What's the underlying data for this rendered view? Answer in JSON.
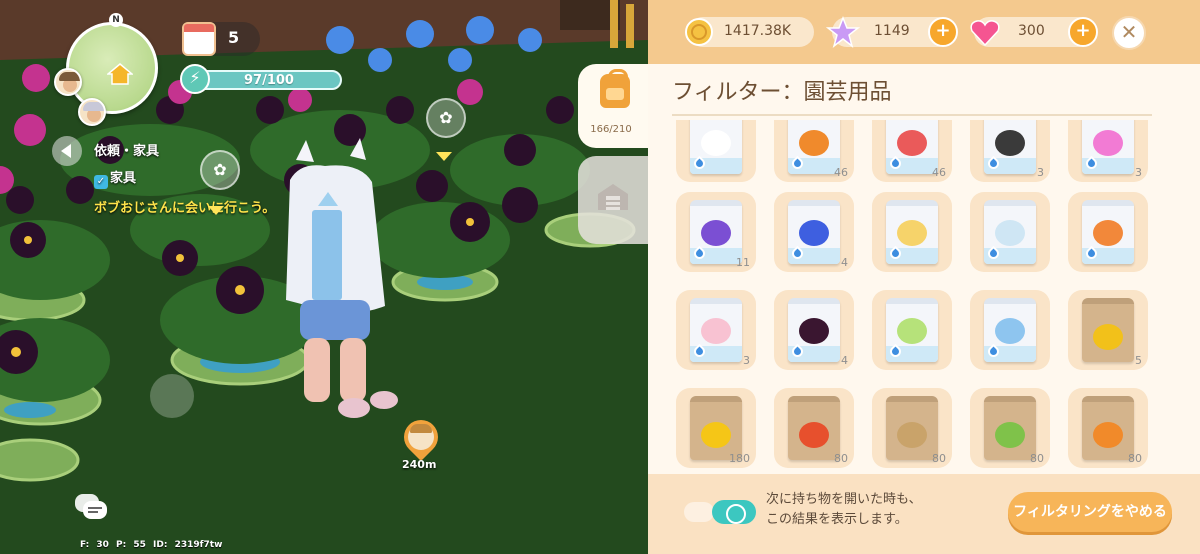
{
  "hud": {
    "minimap_north": "N",
    "quest_count": "5",
    "energy": "97/100",
    "quest_title": "依頼・家具",
    "quest_check": "✓",
    "quest_item": "家具",
    "quest_desc": "ボブおじさんに会いに行こう。",
    "npc_distance": "240m",
    "footer": "F: 30   P: 55   ID: 2319f7tw"
  },
  "side_tabs": {
    "bag_capacity": "166/210"
  },
  "resources": {
    "coins": "1417.38K",
    "stars": "1149",
    "gems": "300",
    "plus": "+",
    "close": "✕"
  },
  "panel": {
    "title": "フィルター：園芸用品"
  },
  "items": [
    {
      "name": "white-rose-seed-pack",
      "kind": "seed",
      "color": "#ffffff",
      "qty": ""
    },
    {
      "name": "orange-rose-seed-pack",
      "kind": "seed",
      "color": "#f08a2c",
      "qty": "46"
    },
    {
      "name": "red-rose-seed-pack",
      "kind": "seed",
      "color": "#ea5a5a",
      "qty": "46"
    },
    {
      "name": "black-rose-seed-pack",
      "kind": "seed",
      "color": "#3a3a3a",
      "qty": "3"
    },
    {
      "name": "pink-rose-seed-pack",
      "kind": "seed",
      "color": "#f27bd4",
      "qty": "3"
    },
    {
      "name": "purple-rose-seed-pack",
      "kind": "seed",
      "color": "#7b4fd3",
      "qty": "11"
    },
    {
      "name": "blue-rose-seed-pack",
      "kind": "seed",
      "color": "#3e5fe0",
      "qty": "4"
    },
    {
      "name": "yellow-rose-seed-pack",
      "kind": "seed",
      "color": "#f6d36a",
      "qty": ""
    },
    {
      "name": "pale-blue-rose-seed-pack",
      "kind": "seed",
      "color": "#cfe6f4",
      "qty": ""
    },
    {
      "name": "orange-lily-seed-pack",
      "kind": "seed",
      "color": "#f2883a",
      "qty": ""
    },
    {
      "name": "pink-flower-seed-pack",
      "kind": "seed",
      "color": "#f8c2d2",
      "qty": "3"
    },
    {
      "name": "dark-lily-seed-pack",
      "kind": "seed",
      "color": "#3a1630",
      "qty": "4"
    },
    {
      "name": "green-flower-seed-pack",
      "kind": "seed",
      "color": "#b6e27a",
      "qty": ""
    },
    {
      "name": "blue-flower-seed-pack",
      "kind": "seed",
      "color": "#8ec5ef",
      "qty": ""
    },
    {
      "name": "starfruit-seed-pack",
      "kind": "veg",
      "color": "#f2c11a",
      "qty": "5"
    },
    {
      "name": "corn-seed-pack",
      "kind": "veg",
      "color": "#f5c617",
      "qty": "180"
    },
    {
      "name": "tomato-seed-pack",
      "kind": "veg",
      "color": "#e7502d",
      "qty": "80"
    },
    {
      "name": "potato-seed-pack",
      "kind": "veg",
      "color": "#c9a36a",
      "qty": "80"
    },
    {
      "name": "cabbage-seed-pack",
      "kind": "veg",
      "color": "#7fc24a",
      "qty": "80"
    },
    {
      "name": "carrot-seed-pack",
      "kind": "veg",
      "color": "#f18a2a",
      "qty": "80"
    }
  ],
  "bottom": {
    "hint_line1": "次に持ち物を開いた時も、",
    "hint_line2": "この結果を表示します。",
    "stop_button": "フィルタリングをやめる"
  },
  "colors": {
    "panel_bg": "#fff8ee",
    "topbar": "#f4c98e",
    "tile": "#fae4c8",
    "accent_orange": "#f7a72c",
    "toggle_teal": "#3cc7c0",
    "energy_teal": "#6bc6c2"
  }
}
